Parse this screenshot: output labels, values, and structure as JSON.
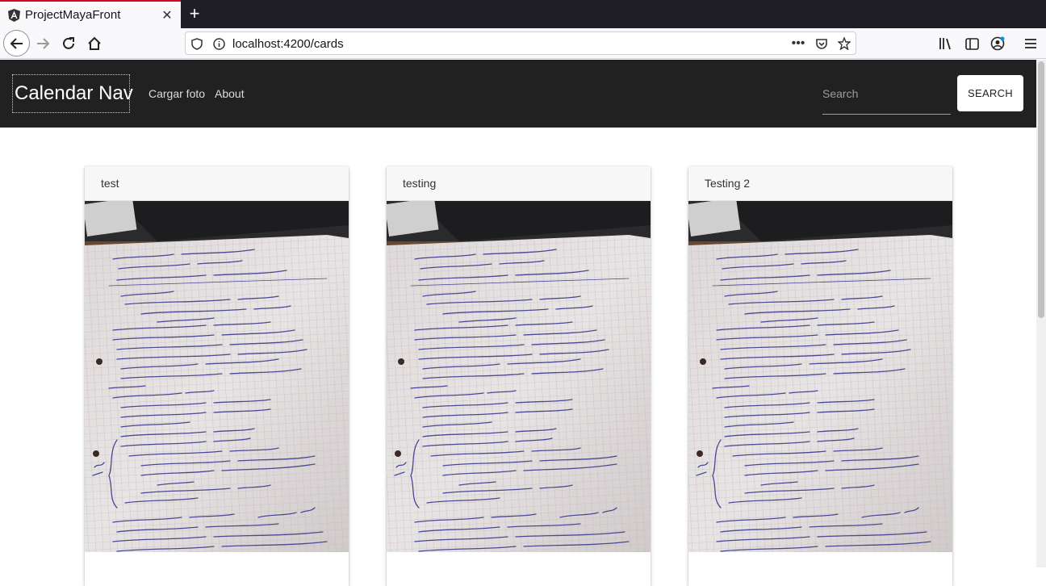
{
  "browser": {
    "tab_title": "ProjectMayaFront",
    "url": "localhost:4200/cards"
  },
  "app": {
    "brand": "Calendar Nav",
    "links": [
      "Cargar foto",
      "About"
    ],
    "search_placeholder": "Search",
    "search_button": "SEARCH"
  },
  "cards": [
    {
      "title": "test"
    },
    {
      "title": "testing"
    },
    {
      "title": "Testing 2"
    }
  ],
  "colors": {
    "toolbar": "#212121",
    "tab_accent": "#d70022"
  }
}
